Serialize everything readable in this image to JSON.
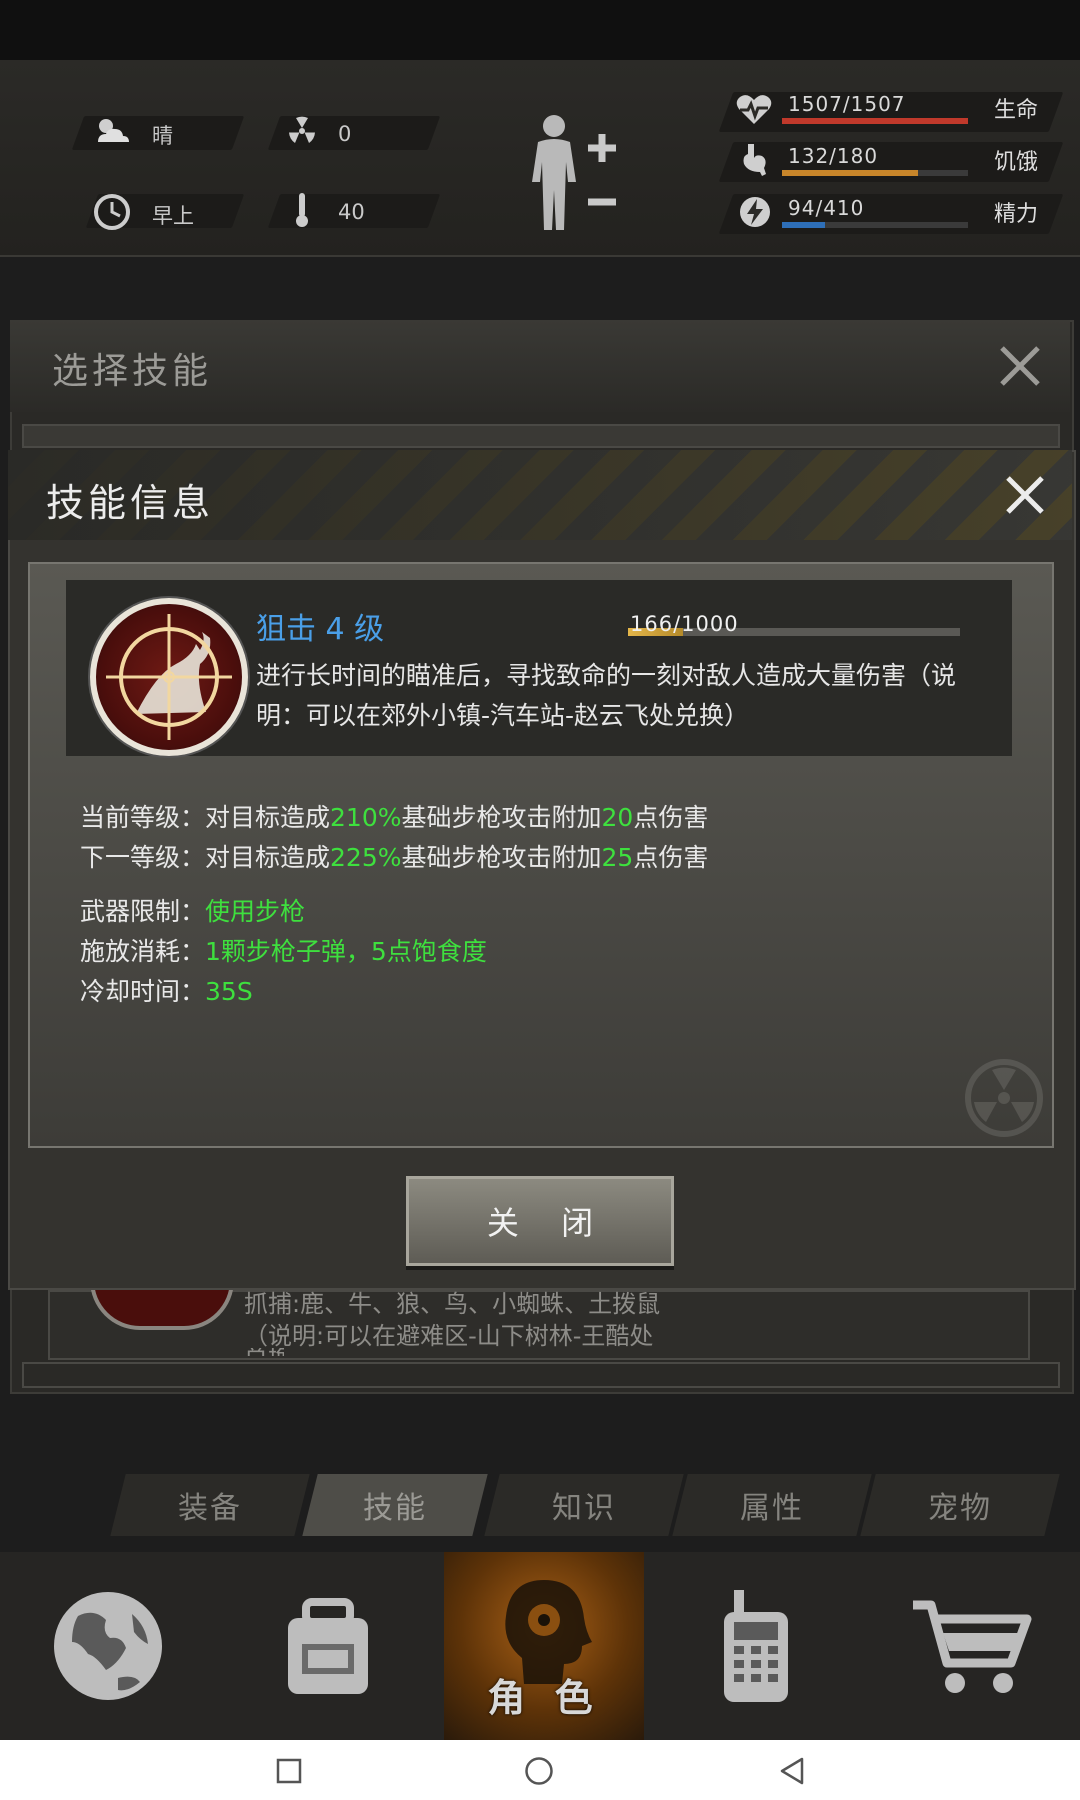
{
  "hud": {
    "weather": "晴",
    "radiation": "0",
    "time_of_day": "早上",
    "temperature": "40",
    "health": {
      "text": "1507/1507",
      "label": "生命",
      "fill": 1.0,
      "color": "#c0392b"
    },
    "hunger": {
      "text": "132/180",
      "label": "饥饿",
      "fill": 0.733,
      "color": "#c8862a"
    },
    "energy": {
      "text": "94/410",
      "label": "精力",
      "fill": 0.229,
      "color": "#2e6fb8"
    }
  },
  "select_panel": {
    "title": "选择技能",
    "behind_line1": "抓捕:鹿、牛、狼、鸟、小蜘蛛、土拨鼠",
    "behind_line2": "（说明:可以在避难区-山下树林-王酷处",
    "behind_line3": "兑换）"
  },
  "dialog": {
    "title": "技能信息",
    "skill_name": "狙击 4 级",
    "xp_text": "166/1000",
    "xp_fill": 0.166,
    "description": "进行长时间的瞄准后，寻找致命的一刻对敌人造成大量伤害（说明：可以在郊外小镇-汽车站-赵云飞处兑换）",
    "current": {
      "label": "当前等级：",
      "a": "对目标造成",
      "pct": "210%",
      "b": "基础步枪攻击附加",
      "dmg": "20",
      "c": "点伤害"
    },
    "next": {
      "label": "下一等级：",
      "a": "对目标造成",
      "pct": "225%",
      "b": "基础步枪攻击附加",
      "dmg": "25",
      "c": "点伤害"
    },
    "weapon": {
      "label": "武器限制：",
      "value": "使用步枪"
    },
    "cost": {
      "label": "施放消耗：",
      "value": "1颗步枪子弹，5点饱食度"
    },
    "cooldown": {
      "label": "冷却时间：",
      "value": "35S"
    },
    "close_button": "关 闭"
  },
  "tabs": [
    {
      "label": "装备",
      "active": false
    },
    {
      "label": "技能",
      "active": true
    },
    {
      "label": "知识",
      "active": false
    },
    {
      "label": "属性",
      "active": false
    },
    {
      "label": "宠物",
      "active": false
    }
  ],
  "nav": {
    "role_label": "角 色"
  },
  "colors": {
    "accent_blue": "#4a9fe8",
    "accent_green": "#3ee03e"
  }
}
